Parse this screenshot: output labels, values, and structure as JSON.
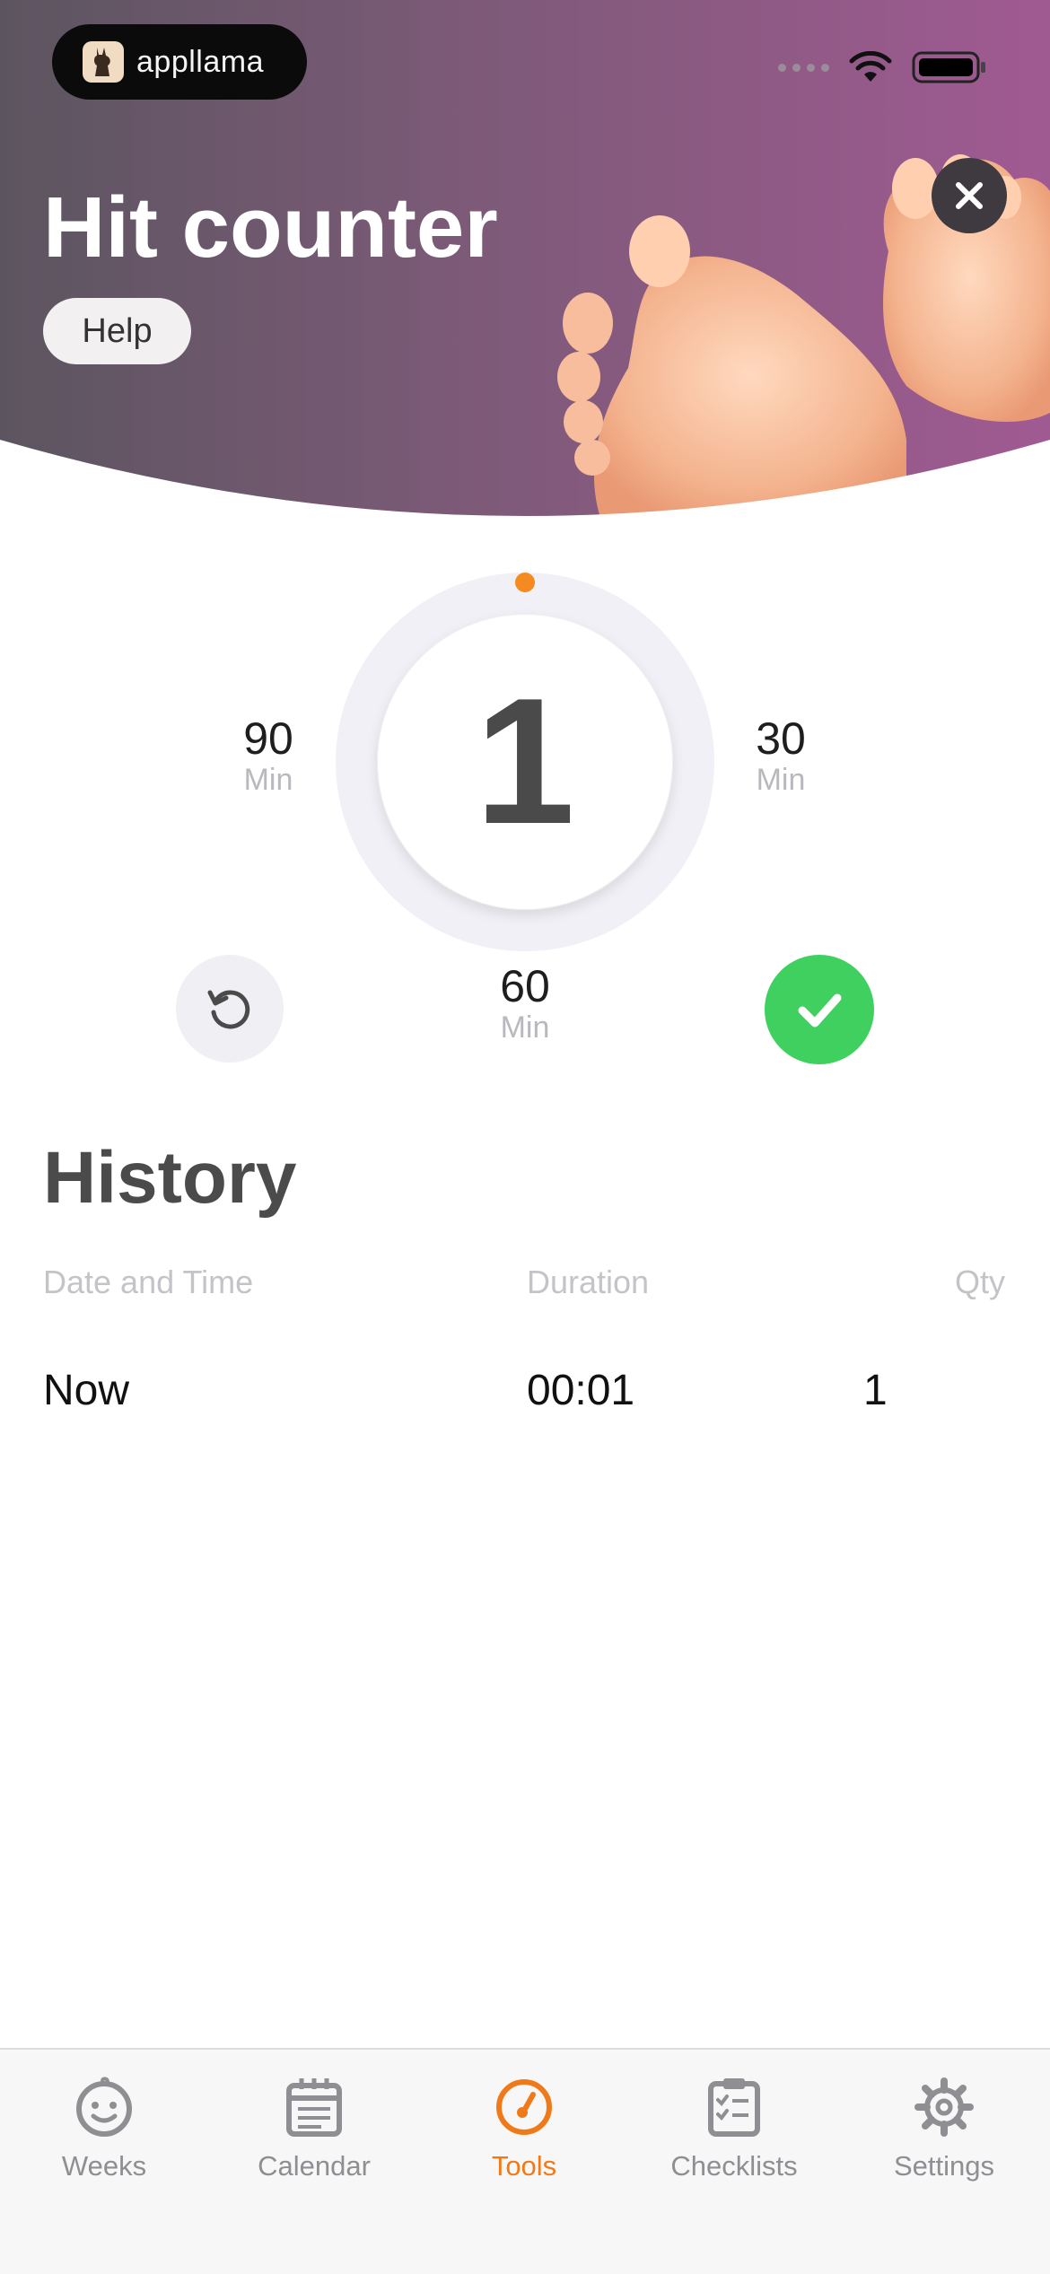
{
  "app": {
    "brand": "appllama",
    "title": "Hit counter",
    "help_label": "Help"
  },
  "counter": {
    "count": "1",
    "progress": 0.0,
    "marks": [
      {
        "value": "90",
        "unit": "Min"
      },
      {
        "value": "30",
        "unit": "Min"
      },
      {
        "value": "60",
        "unit": "Min"
      }
    ]
  },
  "history": {
    "title": "History",
    "columns": [
      "Date and Time",
      "Duration",
      "Qty"
    ],
    "rows": [
      {
        "date_time": "Now",
        "duration": "00:01",
        "qty": "1"
      }
    ]
  },
  "tabs": [
    {
      "label": "Weeks",
      "icon": "baby-face-icon",
      "active": false
    },
    {
      "label": "Calendar",
      "icon": "calendar-icon",
      "active": false
    },
    {
      "label": "Tools",
      "icon": "stopwatch-icon",
      "active": true
    },
    {
      "label": "Checklists",
      "icon": "checklist-icon",
      "active": false
    },
    {
      "label": "Settings",
      "icon": "gear-icon",
      "active": false
    }
  ],
  "colors": {
    "accent": "#f07a1a",
    "success": "#3fd05f",
    "header_start": "#5c5560",
    "header_end": "#a05a92"
  }
}
